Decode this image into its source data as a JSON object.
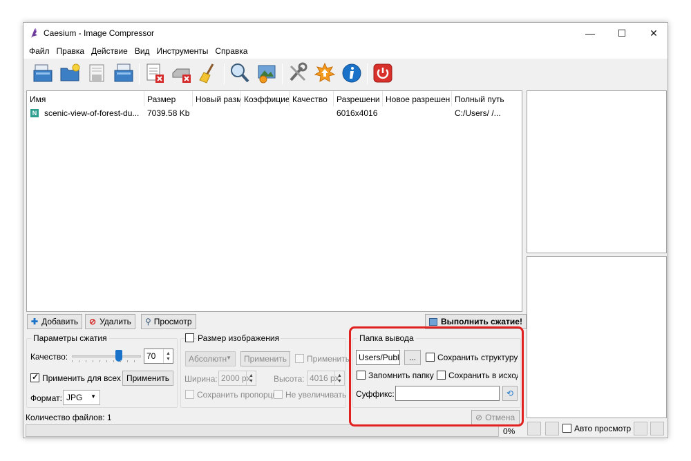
{
  "window": {
    "title": "Caesium - Image Compressor",
    "minimize_glyph": "—",
    "maximize_glyph": "☐",
    "close_glyph": "✕"
  },
  "menu": [
    "Файл",
    "Правка",
    "Действие",
    "Вид",
    "Инструменты",
    "Справка"
  ],
  "toolbar_icons": [
    "open-files-icon",
    "open-folder-icon",
    "save-icon",
    "save-as-icon",
    "remove-item-icon",
    "clear-list-icon",
    "clean-icon",
    "preview-icon",
    "compress-icon",
    "settings-icon",
    "update-icon",
    "info-icon",
    "exit-icon"
  ],
  "table": {
    "columns": [
      "Имя",
      "Размер",
      "Новый разм",
      "Коэффицие",
      "Качество",
      "Разрешени",
      "Новое разрешен",
      "Полный путь"
    ],
    "rows": [
      {
        "name": "scenic-view-of-forest-du...",
        "size": "7039.58 Kb",
        "new_size": "",
        "ratio": "",
        "quality": "",
        "resolution": "6016x4016",
        "new_resolution": "",
        "path": "C:/Users/         /..."
      }
    ]
  },
  "actions": {
    "add": "Добавить",
    "remove": "Удалить",
    "preview": "Просмотр",
    "compress": "Выполнить сжатие!"
  },
  "compression": {
    "group_label": "Параметры сжатия",
    "quality_label": "Качество:",
    "quality_value": "70",
    "quality_fraction": 0.7,
    "apply_all_label": "Применить для всех",
    "apply_all_checked": true,
    "apply_button": "Применить",
    "format_label": "Формат:",
    "format_value": "JPG"
  },
  "resize": {
    "group_label": "Размер изображения",
    "mode_value": "Абсолютн",
    "apply_button": "Применить",
    "apply_check_label": "Применить",
    "width_label": "Ширина:",
    "width_value": "2000 px",
    "height_label": "Высота:",
    "height_value": "4016 px",
    "keep_ratio_label": "Сохранить пропорци",
    "no_enlarge_label": "Не увеличивать"
  },
  "output": {
    "group_label": "Папка вывода",
    "folder_value": "Users/Public",
    "browse_label": "...",
    "keep_structure_label": "Сохранить структуру",
    "remember_folder_label": "Запомнить папку",
    "save_in_source_label": "Сохранить в исходн",
    "suffix_label": "Суффикс:",
    "suffix_value": "",
    "cancel_label": "Отмена"
  },
  "status": {
    "file_count": "Количество файлов: 1",
    "progress_text": "0%",
    "progress_fraction": 0,
    "auto_preview_label": "Авто просмотр"
  },
  "colors": {
    "highlight_frame": "#e1201f",
    "accent_blue": "#1a73c8"
  }
}
